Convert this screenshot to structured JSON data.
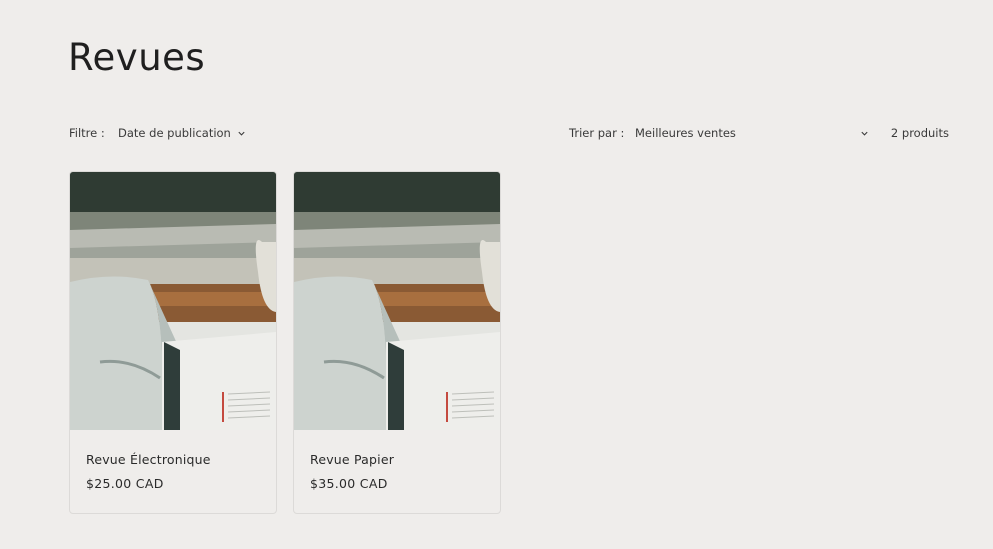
{
  "collection": {
    "title": "Revues"
  },
  "facets": {
    "filter_label": "Filtre :",
    "filter_option": "Date de publication",
    "sort_label": "Trier par :",
    "sort_value": "Meilleures ventes",
    "product_count": "2 produits"
  },
  "products": [
    {
      "title": "Revue Électronique",
      "price": "$25.00 CAD"
    },
    {
      "title": "Revue Papier",
      "price": "$35.00 CAD"
    }
  ],
  "icons": {
    "filter_chevron": "chevron-down-icon",
    "sort_chevron": "chevron-down-icon"
  }
}
